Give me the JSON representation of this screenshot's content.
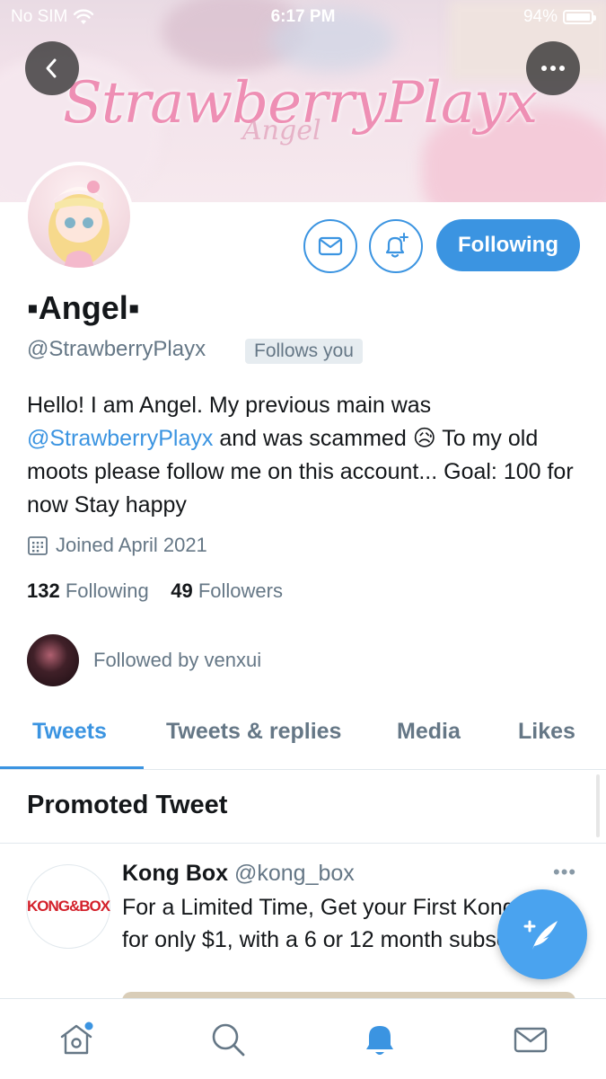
{
  "status_bar": {
    "carrier": "No SIM",
    "time": "6:17 PM",
    "battery": "94%"
  },
  "banner": {
    "title": "StrawberryPlayx",
    "subtitle": "Angel"
  },
  "profile": {
    "name": "▪Angel▪",
    "handle": "@StrawberryPlayx",
    "follows_you": "Follows you",
    "bio_part1": "Hello! I am Angel. My previous main was ",
    "bio_mention": "@StrawberryPlayx",
    "bio_part2": " and was scammed 😥 To my old moots please follow me on this account... Goal: 100 for now Stay happy",
    "joined": "Joined April 2021",
    "following_count": "132",
    "following_label": "Following",
    "followers_count": "49",
    "followers_label": "Followers",
    "followed_by": "Followed by venxui"
  },
  "actions": {
    "following_label": "Following"
  },
  "tabs": [
    {
      "label": "Tweets",
      "active": true
    },
    {
      "label": "Tweets & replies",
      "active": false
    },
    {
      "label": "Media",
      "active": false
    },
    {
      "label": "Likes",
      "active": false
    }
  ],
  "promoted": {
    "header": "Promoted Tweet",
    "logo_text": "KONG&BOX",
    "author_name": "Kong Box",
    "author_handle": "@kong_box",
    "more": "•••",
    "text": "For a Limited Time, Get your First Kong Box for only $1, with a 6 or 12 month subscription!"
  },
  "colors": {
    "accent": "#3b94e1",
    "secondary_text": "#657786",
    "fab": "#4aa3ef"
  },
  "bottom_nav": [
    "home-icon",
    "search-icon",
    "notifications-icon",
    "messages-icon"
  ]
}
